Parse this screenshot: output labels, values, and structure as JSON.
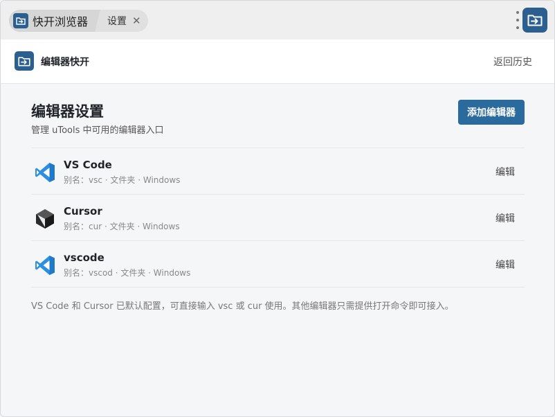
{
  "tabs": {
    "main_label": "快开浏览器",
    "sub_label": "设置",
    "close_glyph": "✕"
  },
  "header": {
    "title": "编辑器快开",
    "back_label": "返回历史"
  },
  "page": {
    "title": "编辑器设置",
    "description": "管理 uTools 中可用的编辑器入口",
    "add_button_label": "添加编辑器"
  },
  "editors": [
    {
      "name": "VS Code",
      "meta": "别名：vsc · 文件夹 · Windows",
      "edit_label": "编辑",
      "icon": "vscode-icon"
    },
    {
      "name": "Cursor",
      "meta": "别名：cur · 文件夹 · Windows",
      "edit_label": "编辑",
      "icon": "cursor-icon"
    },
    {
      "name": "vscode",
      "meta": "别名：vscod · 文件夹 · Windows",
      "edit_label": "编辑",
      "icon": "vscode-icon"
    }
  ],
  "footnote": "VS Code 和 Cursor 已默认配置，可直接输入 vsc 或 cur 使用。其他编辑器只需提供打开命令即可接入。",
  "colors": {
    "brand": "#2a5f8f",
    "button": "#2a6a9c",
    "vscode_blue": "#2d8fe0"
  }
}
